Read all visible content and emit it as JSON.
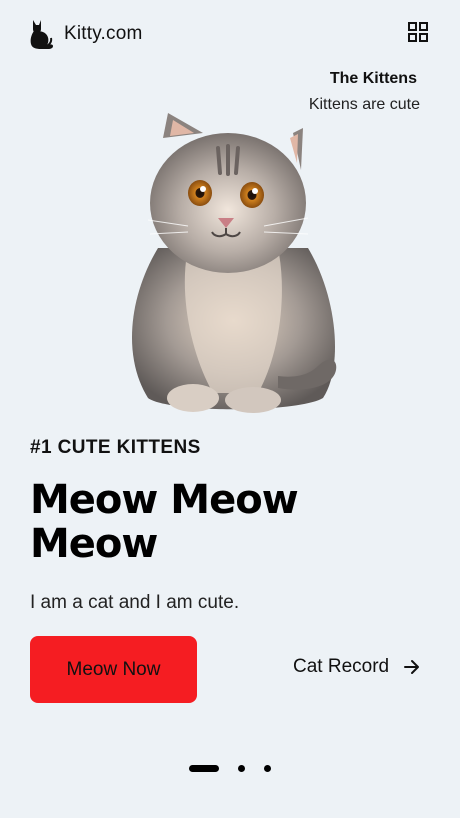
{
  "header": {
    "brand_name": "Kitty.com",
    "brand_icon": "cat-silhouette-icon",
    "menu_icon": "grid-icon"
  },
  "hero": {
    "title": "The Kittens",
    "subtitle": "Kittens are cute",
    "image": "kitten-photo"
  },
  "content": {
    "kicker": "#1 CUTE KITTENS",
    "headline": "Meow Meow Meow",
    "description": "I am a cat and I am cute."
  },
  "actions": {
    "primary_label": "Meow Now",
    "secondary_label": "Cat Record",
    "secondary_icon": "arrow-right-icon"
  },
  "pagination": {
    "total": 3,
    "active_index": 0
  },
  "colors": {
    "background": "#edf2f6",
    "accent": "#f51d22",
    "text": "#111111"
  }
}
